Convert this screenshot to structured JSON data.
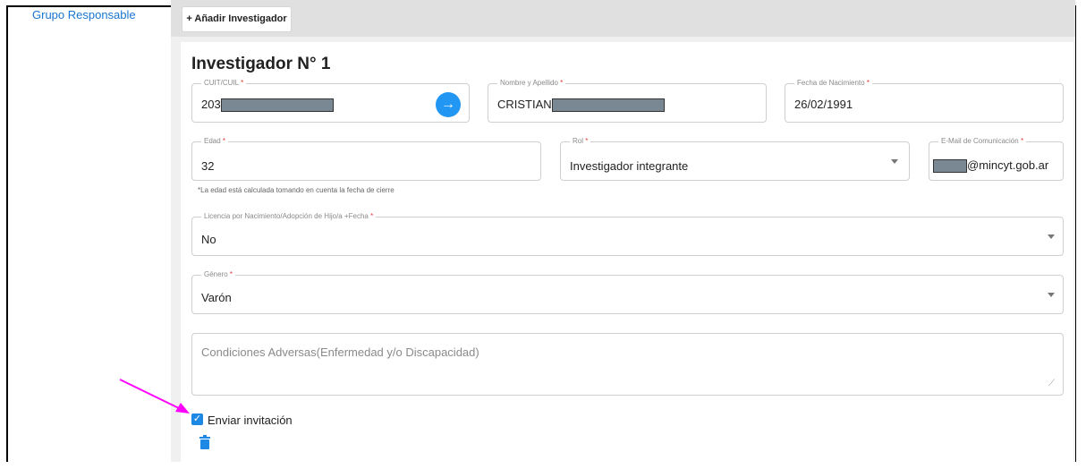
{
  "sidebar": {
    "link_label": "Grupo Responsable"
  },
  "toolbar": {
    "add_label": "+ Añadir Investigador"
  },
  "card": {
    "title": "Investigador N° 1"
  },
  "fields": {
    "cuit": {
      "label": "CUIT/CUIL",
      "value": "203"
    },
    "name": {
      "label": "Nombre y Apellido",
      "value": "CRISTIAN"
    },
    "birth": {
      "label": "Fecha de Nacimiento",
      "value": "26/02/1991"
    },
    "age": {
      "label": "Edad",
      "value": "32",
      "hint": "*La edad está calculada tomando en cuenta la fecha de cierre"
    },
    "role": {
      "label": "Rol",
      "value": "Investigador integrante"
    },
    "email": {
      "label": "E-Mail de Comunicación",
      "value": "@mincyt.gob.ar"
    },
    "license": {
      "label": "Licencia por Nacimiento/Adopción de Hijo/a +Fecha",
      "value": "No"
    },
    "gender": {
      "label": "Género",
      "value": "Varón"
    },
    "conditions": {
      "placeholder": "Condiciones Adversas(Enfermedad y/o Discapacidad)"
    }
  },
  "required_marker": "*",
  "invite": {
    "label": "Enviar invitación",
    "checked": true
  },
  "icons": {
    "arrow": "arrow-right-icon",
    "dropdown": "chevron-down-icon",
    "check": "check-icon",
    "trash": "trash-icon",
    "annotation": "annotation-arrow"
  },
  "colors": {
    "accent": "#1e88e5",
    "link": "#1976d2",
    "required": "#e53935",
    "annotation": "#ff00ff"
  }
}
